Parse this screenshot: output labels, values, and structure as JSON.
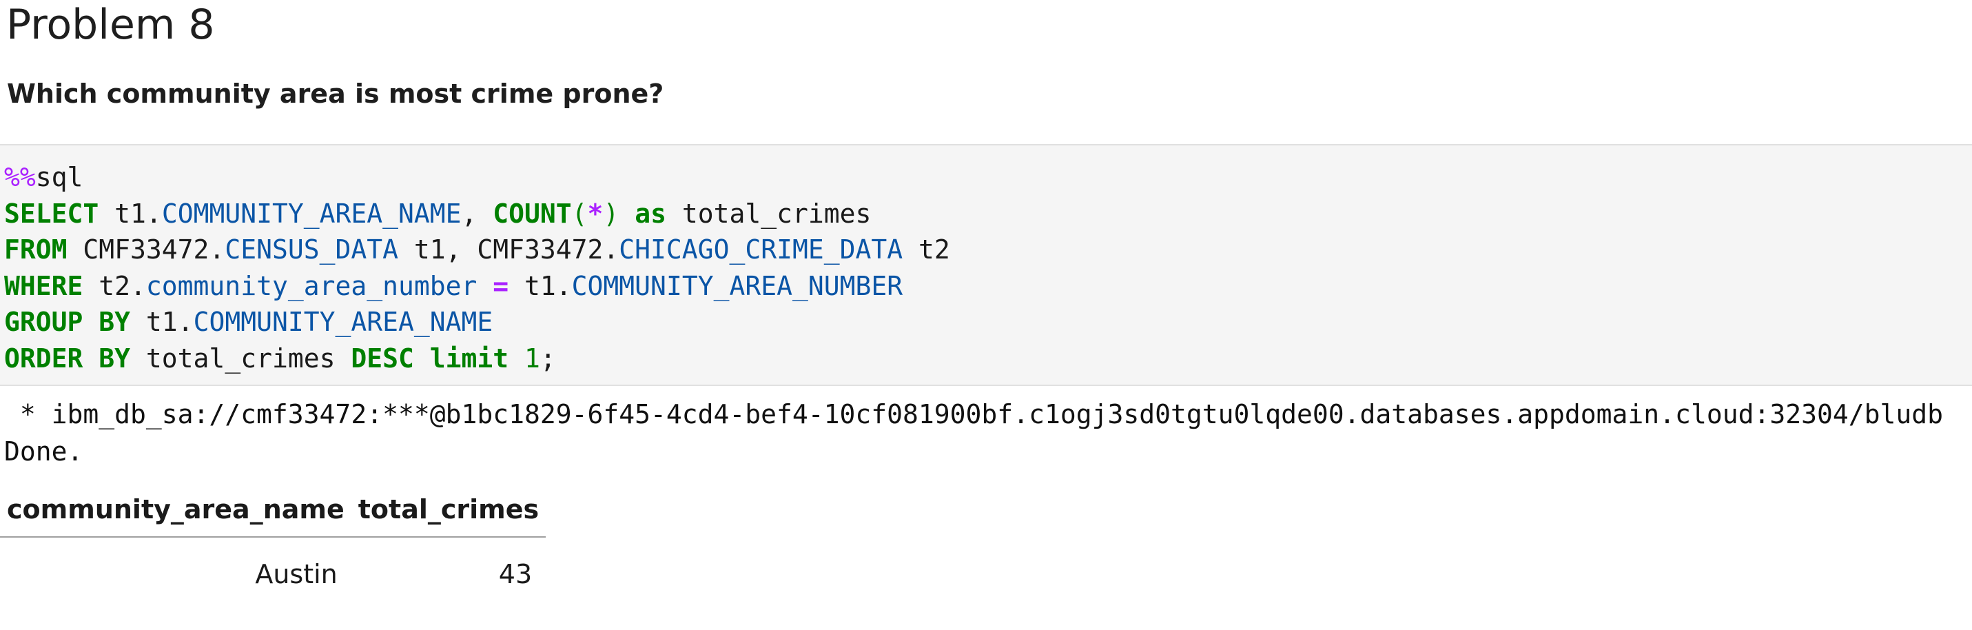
{
  "heading": "Problem 8",
  "question": "Which community area is most crime prone?",
  "code_cell": {
    "line1": {
      "magic_prefix": "%%",
      "magic_name": "sql"
    },
    "line2": {
      "kw_select": "SELECT",
      "t1a": " t1",
      "dot1": ".",
      "col_name": "COMMUNITY_AREA_NAME",
      "comma1": ", ",
      "kw_count": "COUNT",
      "lparen": "(",
      "star": "*",
      "rparen": ")",
      "kw_as": "as",
      "alias": " total_crimes"
    },
    "line3": {
      "kw_from": "FROM",
      "schema1": " CMF33472",
      "dot1": ".",
      "table1": "CENSUS_DATA",
      "t1": " t1, ",
      "schema2": "CMF33472",
      "dot2": ".",
      "table2": "CHICAGO_CRIME_DATA",
      "t2": " t2"
    },
    "line4": {
      "kw_where": "WHERE",
      "t2": " t2",
      "dot1": ".",
      "col_a": "community_area_number",
      "eq": "=",
      "t1": " t1",
      "dot2": ".",
      "col_b": "COMMUNITY_AREA_NUMBER"
    },
    "line5": {
      "kw_group": "GROUP",
      "kw_by": "BY",
      "t1": " t1",
      "dot": ".",
      "col": "COMMUNITY_AREA_NAME"
    },
    "line6": {
      "kw_order": "ORDER",
      "kw_by": "BY",
      "alias": " total_crimes ",
      "kw_desc": "DESC",
      "kw_limit": "limit",
      "num": "1",
      "semi": ";"
    }
  },
  "output": {
    "connection": " * ibm_db_sa://cmf33472:***@b1bc1829-6f45-4cd4-bef4-10cf081900bf.c1ogj3sd0tgtu0lqde00.databases.appdomain.cloud:32304/bludb",
    "status": "Done.",
    "table": {
      "columns": [
        "community_area_name",
        "total_crimes"
      ],
      "rows": [
        [
          "Austin",
          "43"
        ]
      ]
    }
  }
}
